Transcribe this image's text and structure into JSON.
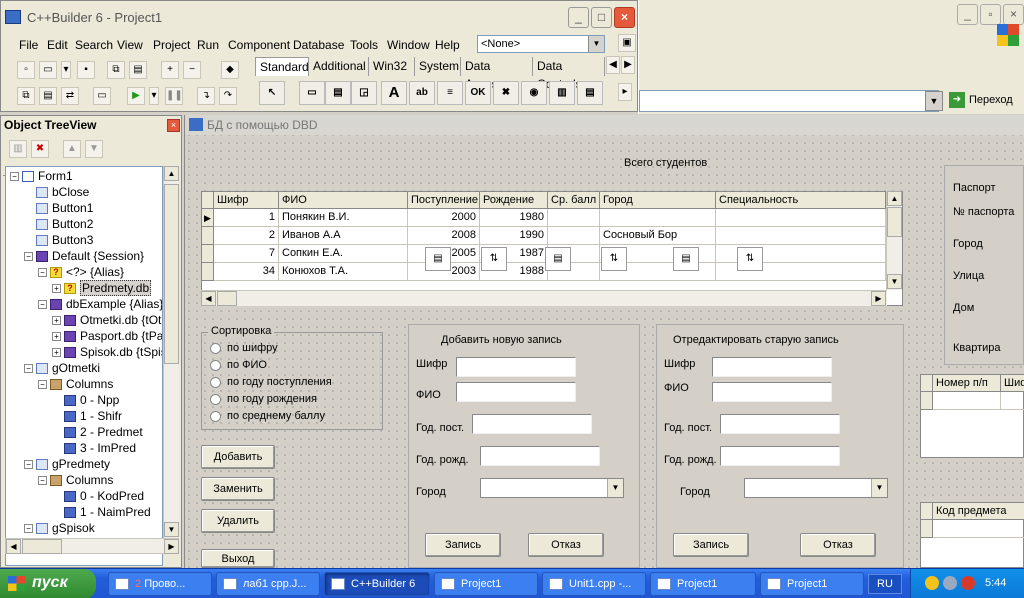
{
  "ide": {
    "title": "C++Builder 6 - Project1",
    "menu": [
      "File",
      "Edit",
      "Search",
      "View",
      "Project",
      "Run",
      "Component",
      "Database",
      "Tools",
      "Window",
      "Help"
    ],
    "desktop_combo": "<None>",
    "palette_tabs": [
      "Standard",
      "Additional",
      "Win32",
      "System",
      "Data Access",
      "Data Controls"
    ],
    "palette_items": [
      "arrow-icon",
      "frame-icon",
      "mainmenu-icon",
      "popupmenu-icon",
      "label-icon",
      "edit-icon",
      "memo-icon",
      "button-icon",
      "checkbox-icon",
      "radiobutton-icon",
      "listbox-icon",
      "combobox-icon"
    ],
    "label_glyph": "A"
  },
  "background_window": {
    "go_label": "Переход"
  },
  "treeview": {
    "title": "Object TreeView",
    "nodes": [
      {
        "label": "Form1",
        "icon": "form",
        "level": 0,
        "expander": "−"
      },
      {
        "label": "bClose",
        "icon": "comp",
        "level": 1
      },
      {
        "label": "Button1",
        "icon": "comp",
        "level": 1
      },
      {
        "label": "Button2",
        "icon": "comp",
        "level": 1
      },
      {
        "label": "Button3",
        "icon": "comp",
        "level": 1
      },
      {
        "label": "Default {Session}",
        "icon": "db",
        "level": 1,
        "expander": "−"
      },
      {
        "label": "<?> {Alias}",
        "icon": "q",
        "level": 2,
        "expander": "−"
      },
      {
        "label": "Predmety.db",
        "icon": "q",
        "level": 3,
        "expander": "+",
        "selected": true
      },
      {
        "label": "dbExample {Alias}",
        "icon": "db",
        "level": 2,
        "expander": "−"
      },
      {
        "label": "Otmetki.db {tOtm",
        "icon": "db",
        "level": 3,
        "expander": "+"
      },
      {
        "label": "Pasport.db {tPas",
        "icon": "db",
        "level": 3,
        "expander": "+"
      },
      {
        "label": "Spisok.db {tSpis",
        "icon": "db",
        "level": 3,
        "expander": "+"
      },
      {
        "label": "gOtmetki",
        "icon": "comp",
        "level": 1,
        "expander": "−"
      },
      {
        "label": "Columns",
        "icon": "cols",
        "level": 2,
        "expander": "−"
      },
      {
        "label": "0 - Npp",
        "icon": "fld",
        "level": 3
      },
      {
        "label": "1 - Shifr",
        "icon": "fld",
        "level": 3
      },
      {
        "label": "2 - Predmet",
        "icon": "fld",
        "level": 3
      },
      {
        "label": "3 - ImPred",
        "icon": "fld",
        "level": 3
      },
      {
        "label": "gPredmety",
        "icon": "comp",
        "level": 1,
        "expander": "−"
      },
      {
        "label": "Columns",
        "icon": "cols",
        "level": 2,
        "expander": "−"
      },
      {
        "label": "0 - KodPred",
        "icon": "fld",
        "level": 3
      },
      {
        "label": "1 - NaimPred",
        "icon": "fld",
        "level": 3
      },
      {
        "label": "gSpisok",
        "icon": "comp",
        "level": 1,
        "expander": "−"
      }
    ]
  },
  "form": {
    "title": "БД с помощью DBD",
    "total_label": "Всего студентов",
    "grid": {
      "columns": [
        "Шифр",
        "ФИО",
        "Поступление",
        "Рождение",
        "Ср. балл",
        "Город",
        "Специальность"
      ],
      "rows": [
        [
          "1",
          "Понякин В.И.",
          "2000",
          "1980",
          "",
          "",
          ""
        ],
        [
          "2",
          "Иванов А.А",
          "2008",
          "1990",
          "",
          "Сосновый Бор",
          ""
        ],
        [
          "7",
          "Сопкин Е.А.",
          "2005",
          "1987",
          "",
          "",
          ""
        ],
        [
          "34",
          "Конюхов Т.А.",
          "2003",
          "1988",
          "",
          "",
          ""
        ]
      ]
    },
    "sort": {
      "caption": "Сортировка",
      "options": [
        "по шифру",
        "по ФИО",
        "по году поступления",
        "по году рождения",
        "по среднему баллу"
      ]
    },
    "buttons": {
      "add": "Добавить",
      "replace": "Заменить",
      "delete": "Удалить",
      "exit": "Выход"
    },
    "add_panel": {
      "title": "Добавить новую запись",
      "shifr": "Шифр",
      "fio": "ФИО",
      "god_post": "Год. пост.",
      "god_rozhd": "Год. рожд.",
      "gorod": "Город",
      "save": "Запись",
      "cancel": "Отказ"
    },
    "edit_panel": {
      "title": "Отредактировать старую запись",
      "shifr": "Шифр",
      "fio": "ФИО",
      "god_post": "Год. пост.",
      "god_rozhd": "Год. рожд.",
      "gorod": "Город",
      "save": "Запись",
      "cancel": "Отказ"
    },
    "passport": {
      "labels": [
        "Паспорт",
        "№ паспорта",
        "Город",
        "Улица",
        "Дом",
        "Квартира"
      ]
    },
    "grid2_headers": [
      "Номер п/п",
      "Шиф"
    ],
    "grid3_headers": [
      "Код предмета"
    ]
  },
  "taskbar": {
    "start": "пуск",
    "tasks": [
      {
        "count": "2",
        "label": "Прово..."
      },
      {
        "label": "лаб1 cpp.J..."
      },
      {
        "label": "C++Builder 6",
        "active": true
      },
      {
        "label": "Project1"
      },
      {
        "label": "Unit1.cpp -..."
      },
      {
        "label": "Project1"
      },
      {
        "label": "Project1"
      }
    ],
    "lang": "RU",
    "time": "5:44"
  }
}
